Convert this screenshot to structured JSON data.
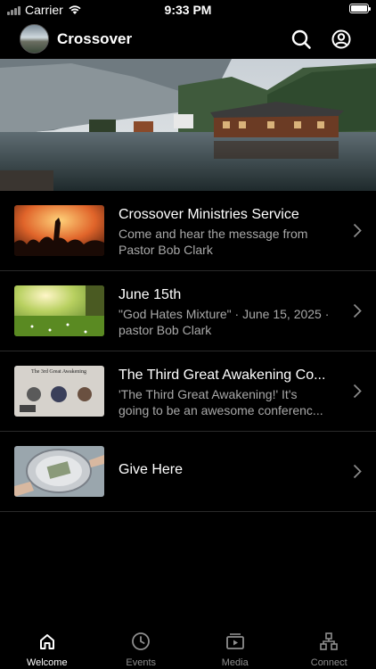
{
  "status_bar": {
    "carrier": "Carrier",
    "time": "9:33 PM"
  },
  "header": {
    "title": "Crossover",
    "search_icon": "search-icon",
    "profile_icon": "user-circle-icon"
  },
  "items": [
    {
      "title": "Crossover Ministries Service",
      "subtitle_line1": "Come and hear the message from",
      "subtitle_line2": "Pastor Bob Clark"
    },
    {
      "title": "June 15th",
      "subtitle_line1": "\"God Hates Mixture\" · June 15, 2025 ·",
      "subtitle_line2": "pastor Bob Clark"
    },
    {
      "title": "The Third Great Awakening Co...",
      "subtitle_line1": "'The Third Great Awakening!'   It's",
      "subtitle_line2": "going to be an awesome conferenc...",
      "thumb_text": "The 3rd Great Awakening"
    },
    {
      "title": "Give Here"
    }
  ],
  "tabs": [
    {
      "label": "Welcome",
      "icon": "home-icon",
      "active": true
    },
    {
      "label": "Events",
      "icon": "clock-icon",
      "active": false
    },
    {
      "label": "Media",
      "icon": "media-play-icon",
      "active": false
    },
    {
      "label": "Connect",
      "icon": "connect-network-icon",
      "active": false
    }
  ]
}
